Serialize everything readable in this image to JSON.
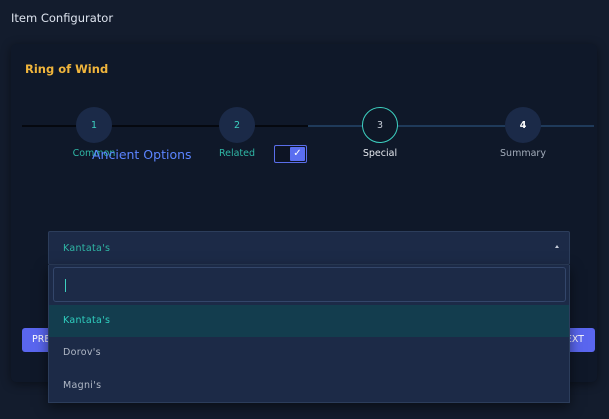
{
  "app": {
    "title": "Item Configurator"
  },
  "card": {
    "title": "Ring of Wind"
  },
  "steps": [
    {
      "number": "1",
      "label": "Common",
      "state": "completed"
    },
    {
      "number": "2",
      "label": "Related",
      "state": "completed"
    },
    {
      "number": "3",
      "label": "Special",
      "state": "current"
    },
    {
      "number": "4",
      "label": "Summary",
      "state": "pending"
    }
  ],
  "option": {
    "label": "Ancient Options",
    "checked": true
  },
  "buttons": {
    "prev": "PREV",
    "next": "NEXT"
  },
  "select": {
    "value": "Kantata's",
    "search_value": "",
    "options": [
      "Kantata's",
      "Dorov's",
      "Magni's"
    ],
    "selected_index": 0
  },
  "colors": {
    "background": "#131c2d",
    "title_accent": "#f0b53c",
    "teal": "#2fb7a6",
    "primary_button": "#5a66ef",
    "option_label": "#5b84ff"
  }
}
